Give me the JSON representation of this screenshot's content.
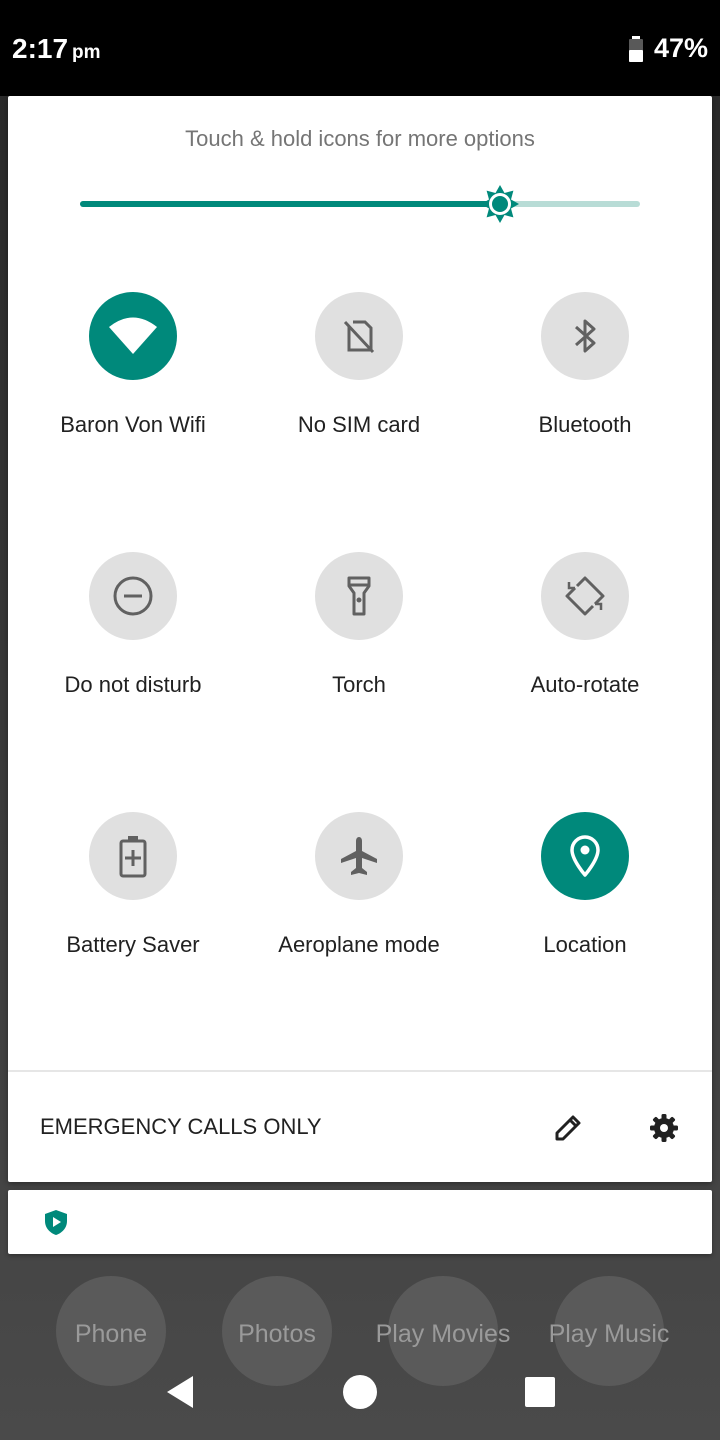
{
  "status_bar": {
    "time": "2:17",
    "ampm": "pm",
    "battery_percent": "47%",
    "battery_icon": "battery-icon"
  },
  "quick_settings": {
    "hint": "Touch & hold icons for more options",
    "brightness_level": 0.75,
    "accent_color": "#00897b",
    "inactive_tile_color": "#e0e0e0",
    "tiles": [
      {
        "label": "Baron Von Wifi",
        "icon": "wifi-icon",
        "active": true
      },
      {
        "label": "No SIM card",
        "icon": "no-sim-icon",
        "active": false
      },
      {
        "label": "Bluetooth",
        "icon": "bluetooth-icon",
        "active": false
      },
      {
        "label": "Do not disturb",
        "icon": "do-not-disturb-icon",
        "active": false
      },
      {
        "label": "Torch",
        "icon": "torch-icon",
        "active": false
      },
      {
        "label": "Auto-rotate",
        "icon": "auto-rotate-icon",
        "active": false
      },
      {
        "label": "Battery Saver",
        "icon": "battery-saver-icon",
        "active": false
      },
      {
        "label": "Aeroplane mode",
        "icon": "airplane-icon",
        "active": false
      },
      {
        "label": "Location",
        "icon": "location-icon",
        "active": true
      }
    ],
    "footer": {
      "carrier_text": "EMERGENCY CALLS ONLY",
      "edit_icon": "pencil-icon",
      "settings_icon": "gear-icon"
    }
  },
  "notification": {
    "icon": "play-protect-icon"
  },
  "home_dock": {
    "apps": [
      "Phone",
      "Photos",
      "Play Movies",
      "Play Music"
    ]
  },
  "nav_bar": {
    "back_icon": "back-icon",
    "home_icon": "home-icon",
    "recents_icon": "recents-icon"
  }
}
